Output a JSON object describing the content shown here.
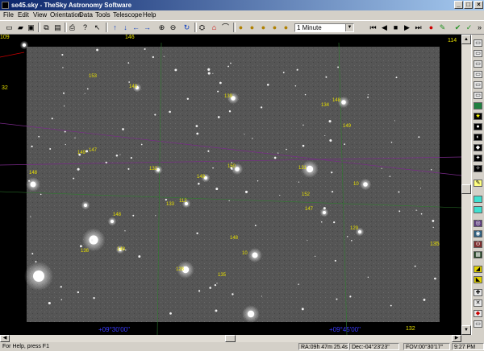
{
  "window": {
    "title": "se45.sky - TheSky Astronomy Software"
  },
  "menu": [
    "File",
    "Edit",
    "View",
    "Orientation",
    "Data",
    "Tools",
    "Telescope",
    "Help"
  ],
  "toolbar": {
    "time_step": "1 Minute"
  },
  "chart": {
    "labels": [
      "153",
      "143",
      "139",
      "134",
      "148",
      "149",
      "149",
      "147",
      "132",
      "148",
      "150",
      "149",
      "131",
      "10",
      "152",
      "112",
      "133",
      "148",
      "147",
      "148",
      "129",
      "10",
      "136",
      "148",
      "128",
      "135"
    ],
    "edge_labels": [
      "109",
      "32",
      "114",
      "135",
      "132",
      "146"
    ],
    "coord_labels": [
      "+09°30'00\"",
      "+09°45'00\""
    ]
  },
  "status": {
    "help": "For Help, press F1",
    "ra": "RA:09h 47m 25.4s",
    "dec": "Dec:-04°23'23\"",
    "fov": "FOV:00°30'17\"",
    "time": "9:27 PM"
  },
  "colors": {
    "title_start": "#0a246a",
    "title_end": "#a6caf0",
    "label": "#e8e000",
    "grid": "#2e7d2e",
    "coord": "#3a3aff"
  }
}
